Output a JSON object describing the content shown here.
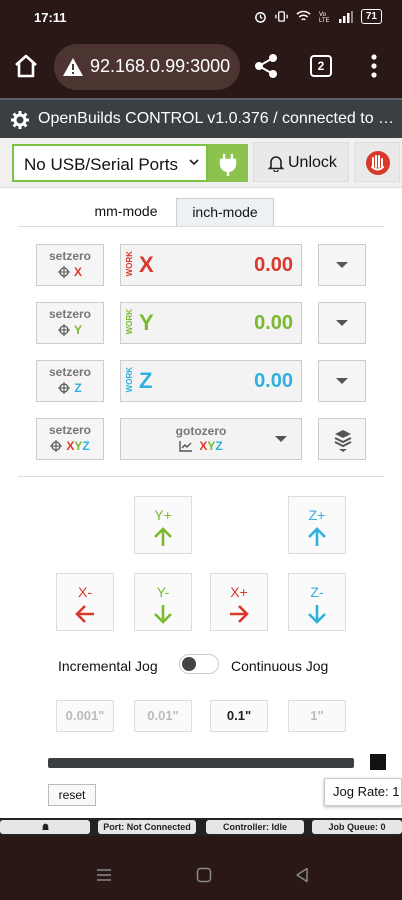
{
  "status_bar": {
    "time": "17:11",
    "battery": "71"
  },
  "browser": {
    "url": "92.168.0.99:3000",
    "tab_count": "2"
  },
  "app": {
    "title": "OpenBuilds CONTROL v1.0.376 / connected to CO..."
  },
  "connection": {
    "port_label": "No USB/Serial Ports",
    "unlock_label": "Unlock"
  },
  "tabs": [
    {
      "label": "mm-mode"
    },
    {
      "label": "inch-mode"
    }
  ],
  "axes": [
    {
      "setzero": "setzero",
      "axis": "X",
      "work": "WORK",
      "value": "0.00",
      "color": "#d9392b"
    },
    {
      "setzero": "setzero",
      "axis": "Y",
      "work": "WORK",
      "value": "0.00",
      "color": "#7ab930"
    },
    {
      "setzero": "setzero",
      "axis": "Z",
      "work": "WORK",
      "value": "0.00",
      "color": "#2fb0dd"
    }
  ],
  "setzero_all": {
    "label": "setzero",
    "axes": [
      "X",
      "Y",
      "Z"
    ]
  },
  "gotozero": {
    "label": "gotozero",
    "axes": [
      "X",
      "Y",
      "Z"
    ]
  },
  "jog": {
    "y_plus": "Y+",
    "y_minus": "Y-",
    "x_minus": "X-",
    "x_plus": "X+",
    "z_plus": "Z+",
    "z_minus": "Z-",
    "incremental_label": "Incremental Jog",
    "continuous_label": "Continuous Jog",
    "steps": [
      "0.001\"",
      "0.01\"",
      "0.1\"",
      "1\""
    ],
    "active_step": "0.1\"",
    "reset_label": "reset",
    "rate_label": "Jog Rate: 1"
  },
  "bottom_status": {
    "port": "Port: Not Connected",
    "controller": "Controller: Idle",
    "queue": "Job Queue: 0"
  }
}
